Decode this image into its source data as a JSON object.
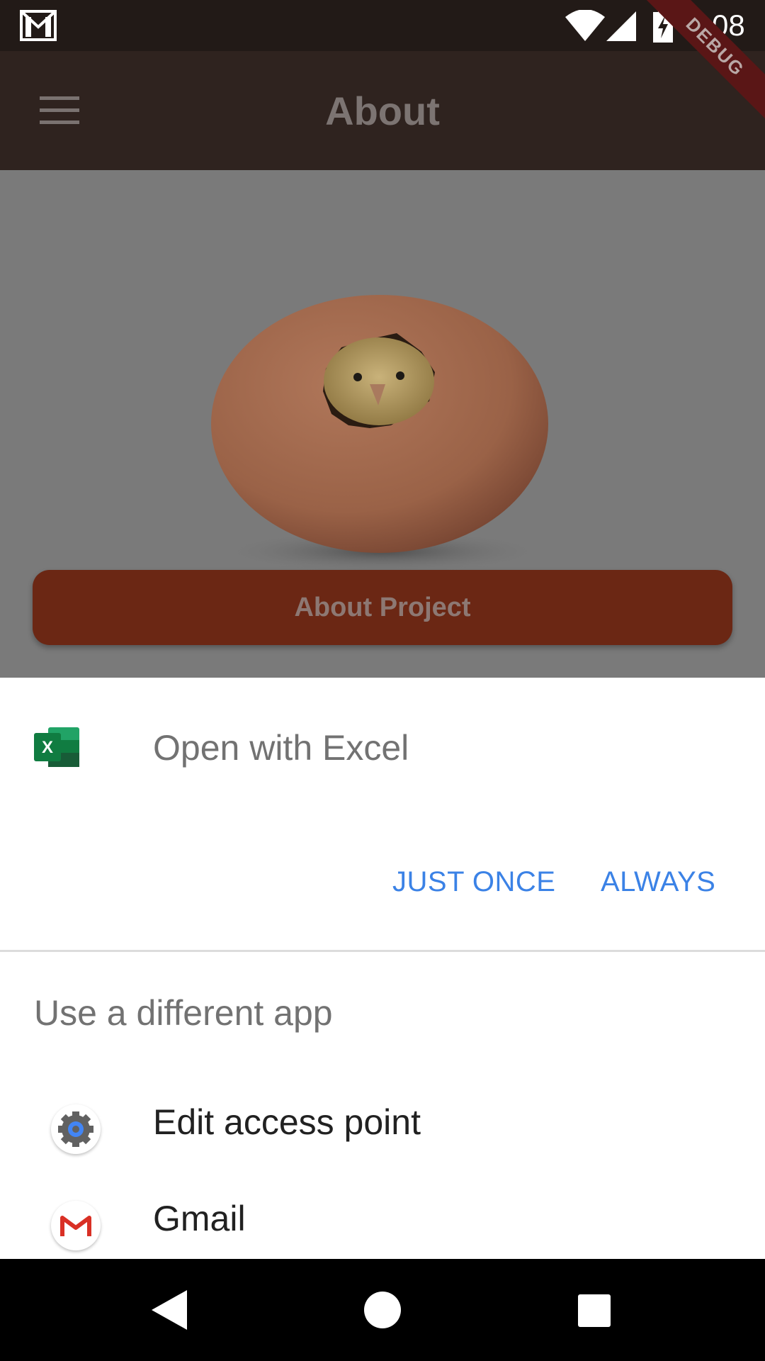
{
  "status_bar": {
    "time": "9:08"
  },
  "app_bar": {
    "title": "About",
    "debug_label": "DEBUG"
  },
  "content": {
    "about_button_label": "About Project"
  },
  "chooser": {
    "title": "Open with Excel",
    "just_once_label": "JUST ONCE",
    "always_label": "ALWAYS",
    "different_app_label": "Use a different app",
    "apps": [
      {
        "name": "Edit access point",
        "icon": "settings-gear-icon"
      },
      {
        "name": "Gmail",
        "icon": "gmail-icon"
      }
    ]
  },
  "colors": {
    "accent": "#3b82e6",
    "app_bar": "#2f231f",
    "button": "#6b2714"
  }
}
